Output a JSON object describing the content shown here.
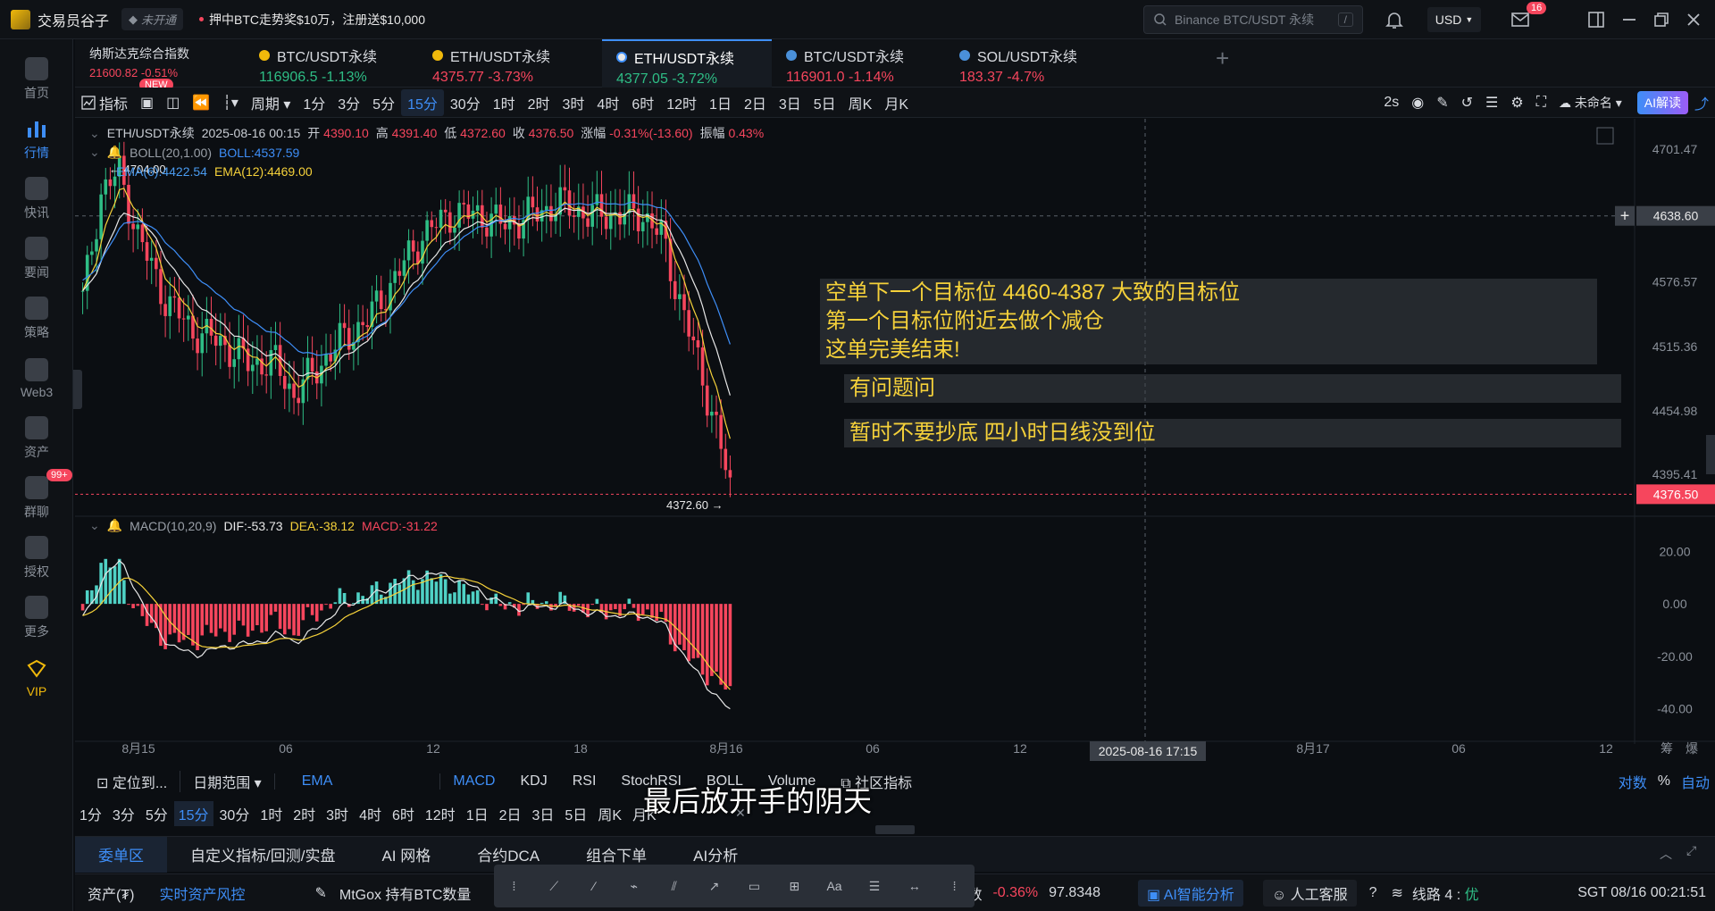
{
  "titlebar": {
    "app_name": "交易员谷子",
    "account_status": "未开通",
    "promo": "押中BTC走势奖$10万，注册送$10,000",
    "search_placeholder": "Binance BTC/USDT 永续",
    "search_shortcut": "/",
    "currency": "USD",
    "mail_count": "16"
  },
  "leftnav": {
    "items": [
      {
        "label": "首页",
        "icon": "home-icon"
      },
      {
        "label": "行情",
        "icon": "market-icon",
        "active": true
      },
      {
        "label": "快讯",
        "icon": "flash-icon"
      },
      {
        "label": "要闻",
        "icon": "news-icon"
      },
      {
        "label": "策略",
        "icon": "strategy-icon"
      },
      {
        "label": "Web3",
        "icon": "web3-icon"
      },
      {
        "label": "资产",
        "icon": "wallet-icon"
      },
      {
        "label": "群聊",
        "icon": "chat-icon",
        "badge": "99+"
      },
      {
        "label": "授权",
        "icon": "key-icon"
      },
      {
        "label": "更多",
        "icon": "more-icon"
      },
      {
        "label": "VIP",
        "icon": "vip-icon"
      }
    ]
  },
  "symbol_tabs": [
    {
      "name": "纳斯达克综合指数",
      "price": "21600.82",
      "change": "-0.51%",
      "badge": "NEW",
      "color": "#f6465d"
    },
    {
      "name": "BTC/USDT永续",
      "price": "116906.5",
      "change": "-1.13%",
      "color": "#2ebd85"
    },
    {
      "name": "ETH/USDT永续",
      "price": "4375.77",
      "change": "-3.73%",
      "color": "#f6465d"
    },
    {
      "name": "ETH/USDT永续",
      "price": "4377.05",
      "change": "-3.72%",
      "color": "#2ebd85",
      "active": true
    },
    {
      "name": "BTC/USDT永续",
      "price": "116901.0",
      "change": "-1.14%",
      "color": "#f6465d"
    },
    {
      "name": "SOL/USDT永续",
      "price": "183.37",
      "change": "-4.7%",
      "color": "#f6465d"
    }
  ],
  "toolbar": {
    "indicator_label": "指标",
    "period_label": "周期",
    "intervals": [
      "1分",
      "3分",
      "5分",
      "15分",
      "30分",
      "1时",
      "2时",
      "3时",
      "4时",
      "6时",
      "12时",
      "1日",
      "2日",
      "3日",
      "5日",
      "周K",
      "月K"
    ],
    "active_interval": "15分",
    "refresh": "2s",
    "layout_name": "未命名",
    "ai_button": "AI解读"
  },
  "chart_header": {
    "symbol": "ETH/USDT永续",
    "time": "2025-08-16 00:15",
    "open_label": "开",
    "open": "4390.10",
    "high_label": "高",
    "high": "4391.40",
    "low_label": "低",
    "low": "4372.60",
    "close_label": "收",
    "close": "4376.50",
    "change_label": "涨幅",
    "change": "-0.31%(-13.60)",
    "amp_label": "振幅",
    "amp": "0.43%",
    "boll": "BOLL(20,1.00)",
    "boll_val": "BOLL:4537.59",
    "ema6": "EMA(6):4422.54",
    "ema12": "EMA(12):4469.00",
    "macd": "MACD(10,20,9)",
    "dif": "DIF:-53.73",
    "dea": "DEA:-38.12",
    "macd_val": "MACD:-31.22",
    "high_mark": "4704.00",
    "low_mark": "4372.60"
  },
  "price_axis": {
    "ticks": [
      "4701.47",
      "4638.60",
      "4576.57",
      "4515.36",
      "4454.98",
      "4395.41"
    ],
    "crosshair_price": "4638.60",
    "last_price": "4376.50",
    "macd_ticks": [
      "20.00",
      "0.00",
      "-20.00",
      "-40.00"
    ]
  },
  "time_axis": {
    "ticks": [
      "8月15",
      "06",
      "12",
      "18",
      "8月16",
      "06",
      "12",
      "8月17",
      "06",
      "12"
    ],
    "crosshair_time": "2025-08-16 17:15",
    "right_labels": [
      "筹",
      "爆"
    ]
  },
  "annotations": {
    "a1_line1": "空单下一个目标位 4460-4387 大致的目标位",
    "a1_line2": "第一个目标位附近去做个减仓",
    "a1_line3": "这单完美结束!",
    "a2": "有问题问",
    "a3": "暂时不要抄底 四小时日线没到位"
  },
  "subtitle": "最后放开手的阴天",
  "controls": {
    "locate": "定位到...",
    "date_range": "日期范围",
    "ema": "EMA",
    "indicators": [
      "MACD",
      "KDJ",
      "RSI",
      "StochRSI",
      "BOLL",
      "Volume"
    ],
    "community": "社区指标",
    "log_label": "对数",
    "pct_label": "%",
    "auto_label": "自动",
    "quick_intervals": [
      "1分",
      "3分",
      "5分",
      "15分",
      "30分",
      "1时",
      "2时",
      "3时",
      "4时",
      "6时",
      "12时",
      "1日",
      "2日",
      "3日",
      "5日",
      "周K",
      "月K"
    ]
  },
  "bottom_tabs": [
    "委单区",
    "自定义指标/回测/实盘",
    "AI 网格",
    "合约DCA",
    "组合下单",
    "AI分析"
  ],
  "statusbar": {
    "assets": "资产(₮)",
    "risk": "实时资产风控",
    "ticker_text": "MtGox 持有BTC数量",
    "index_label": "指数",
    "index_change": "-0.36%",
    "index_value": "97.8348",
    "ai_analysis": "AI智能分析",
    "support": "人工客服",
    "line": "线路 4 : ",
    "line_quality": "优",
    "clock": "SGT 08/16 00:21:51"
  },
  "colors": {
    "up": "#2ebd85",
    "down": "#f6465d",
    "accent": "#3e8ef7",
    "ema6": "#4a9bf0",
    "ema12": "#f5d13a"
  }
}
